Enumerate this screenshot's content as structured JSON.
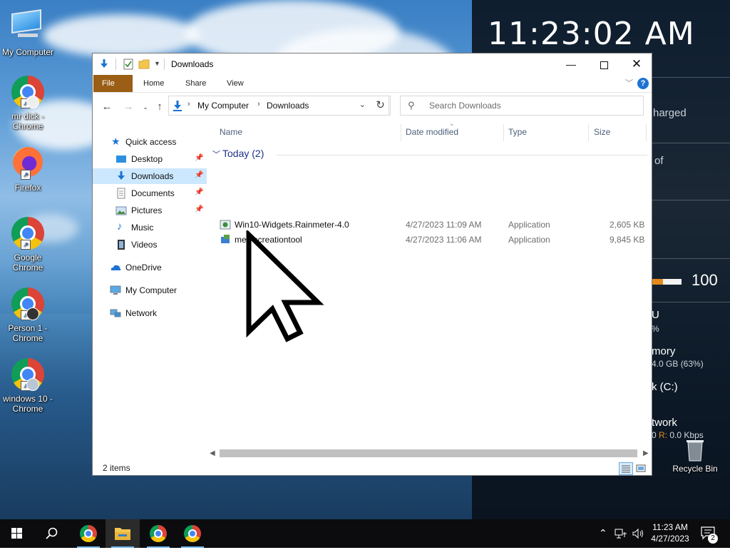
{
  "desktop": {
    "clock": "11:23:02 AM",
    "icons": [
      {
        "label": "My Computer"
      },
      {
        "label": "mr dick - Chrome"
      },
      {
        "label": "Firefox"
      },
      {
        "label": "Google Chrome"
      },
      {
        "label": "Person 1 - Chrome"
      },
      {
        "label": "windows 10 - Chrome"
      },
      {
        "label": "Recycle Bin"
      }
    ],
    "widgets": {
      "charged_text": "harged",
      "of_text": "of",
      "battery_value": "100",
      "cpu_label": "U",
      "cpu_value": "%",
      "memory_label": "mory",
      "memory_value": "4.0 GB (63%)",
      "disk_label": "k (C:)",
      "network_label": "twork",
      "network_value_prefix": "0",
      "network_r_label": "R:",
      "network_value": "0.0 Kbps",
      "accent_color": "#e58a1a"
    }
  },
  "explorer": {
    "title": "Downloads",
    "ribbon": {
      "tabs": [
        "File",
        "Home",
        "Share",
        "View"
      ],
      "help": "?"
    },
    "address": {
      "crumbs": [
        "My Computer",
        "Downloads"
      ]
    },
    "search": {
      "placeholder": "Search Downloads"
    },
    "nav_pane": {
      "items": [
        {
          "label": "Quick access",
          "icon": "star-icon",
          "pinned": false
        },
        {
          "label": "Desktop",
          "icon": "desktop-folder-icon",
          "pinned": true
        },
        {
          "label": "Downloads",
          "icon": "downloads-folder-icon",
          "pinned": true,
          "selected": true
        },
        {
          "label": "Documents",
          "icon": "documents-folder-icon",
          "pinned": true
        },
        {
          "label": "Pictures",
          "icon": "pictures-folder-icon",
          "pinned": true
        },
        {
          "label": "Music",
          "icon": "music-folder-icon",
          "pinned": false
        },
        {
          "label": "Videos",
          "icon": "videos-folder-icon",
          "pinned": false
        },
        {
          "label": "OneDrive",
          "icon": "onedrive-icon",
          "pinned": false
        },
        {
          "label": "My Computer",
          "icon": "computer-icon",
          "pinned": false
        },
        {
          "label": "Network",
          "icon": "network-icon",
          "pinned": false
        }
      ]
    },
    "columns": [
      "Name",
      "Date modified",
      "Type",
      "Size"
    ],
    "group": {
      "label": "Today (2)"
    },
    "files": [
      {
        "name": "Win10-Widgets.Rainmeter-4.0",
        "date": "4/27/2023 11:09 AM",
        "type": "Application",
        "size": "2,605 KB",
        "icon": "installer-icon"
      },
      {
        "name": "mediacreationtool",
        "date": "4/27/2023 11:06 AM",
        "type": "Application",
        "size": "9,845 KB",
        "icon": "media-creation-tool-icon"
      }
    ],
    "status": "2 items"
  },
  "taskbar": {
    "time": "11:23 AM",
    "date": "4/27/2023",
    "notification_count": "2"
  }
}
